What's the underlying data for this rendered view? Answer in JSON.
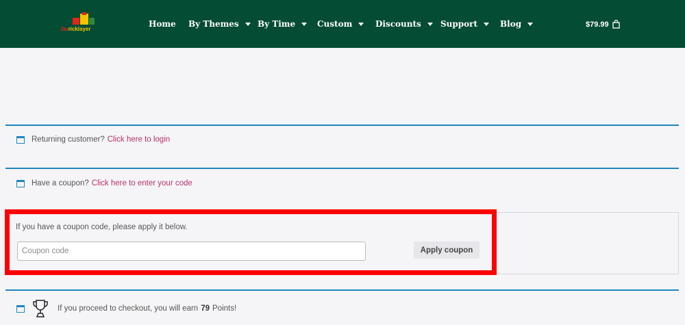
{
  "header": {
    "logo_text_red": "Jiu",
    "logo_text_yellow": "ricklayer",
    "nav": [
      {
        "label": "Home",
        "has_dropdown": false
      },
      {
        "label": "By Themes",
        "has_dropdown": true
      },
      {
        "label": "By Time",
        "has_dropdown": true
      },
      {
        "label": "Custom",
        "has_dropdown": true
      },
      {
        "label": "Discounts",
        "has_dropdown": true
      },
      {
        "label": "Support",
        "has_dropdown": true
      },
      {
        "label": "Blog",
        "has_dropdown": true
      }
    ],
    "cart_total": "$79.99"
  },
  "notices": {
    "login_text": "Returning customer?",
    "login_link": "Click here to login",
    "coupon_text": "Have a coupon?",
    "coupon_link": "Click here to enter your code",
    "points_text_before": "If you proceed to checkout, you will earn",
    "points_value": "79",
    "points_text_after": "Points!"
  },
  "coupon_form": {
    "description": "If you have a coupon code, please apply it below.",
    "input_value": "",
    "input_placeholder": "Coupon code",
    "apply_label": "Apply coupon"
  },
  "colors": {
    "header_bg": "#054c34",
    "accent_blue": "#1e85be",
    "link": "#b6306a",
    "highlight": "#ff0000"
  }
}
